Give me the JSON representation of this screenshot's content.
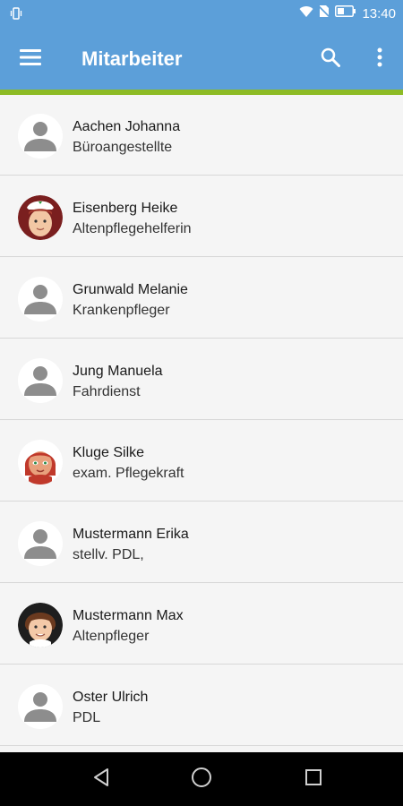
{
  "status_bar": {
    "time": "13:40",
    "icons": [
      "vibrate-icon",
      "wifi-icon",
      "no-sim-icon",
      "battery-icon"
    ]
  },
  "app_bar": {
    "title": "Mitarbeiter",
    "color": "#5c9fd9",
    "accent": "#8dbb25",
    "icons": [
      "menu-icon",
      "search-icon",
      "more-vert-icon"
    ]
  },
  "employees": [
    {
      "name": "Aachen Johanna",
      "role": "Büroangestellte",
      "avatar": "default-person-icon"
    },
    {
      "name": "Eisenberg Heike",
      "role": "Altenpflegehelferin",
      "avatar": "nurse-avatar"
    },
    {
      "name": "Grunwald Melanie",
      "role": "Krankenpfleger",
      "avatar": "default-person-icon"
    },
    {
      "name": "Jung Manuela",
      "role": "Fahrdienst",
      "avatar": "default-person-icon"
    },
    {
      "name": "Kluge Silke",
      "role": "exam. Pflegekraft",
      "avatar": "red-hair-woman-avatar"
    },
    {
      "name": "Mustermann Erika",
      "role": "stellv. PDL,",
      "avatar": "default-person-icon"
    },
    {
      "name": "Mustermann Max",
      "role": "Altenpfleger",
      "avatar": "brown-hair-man-avatar"
    },
    {
      "name": "Oster Ulrich",
      "role": "PDL",
      "avatar": "default-person-icon"
    }
  ],
  "nav_bar": {
    "icons": [
      "back-icon",
      "home-icon",
      "recents-icon"
    ]
  }
}
